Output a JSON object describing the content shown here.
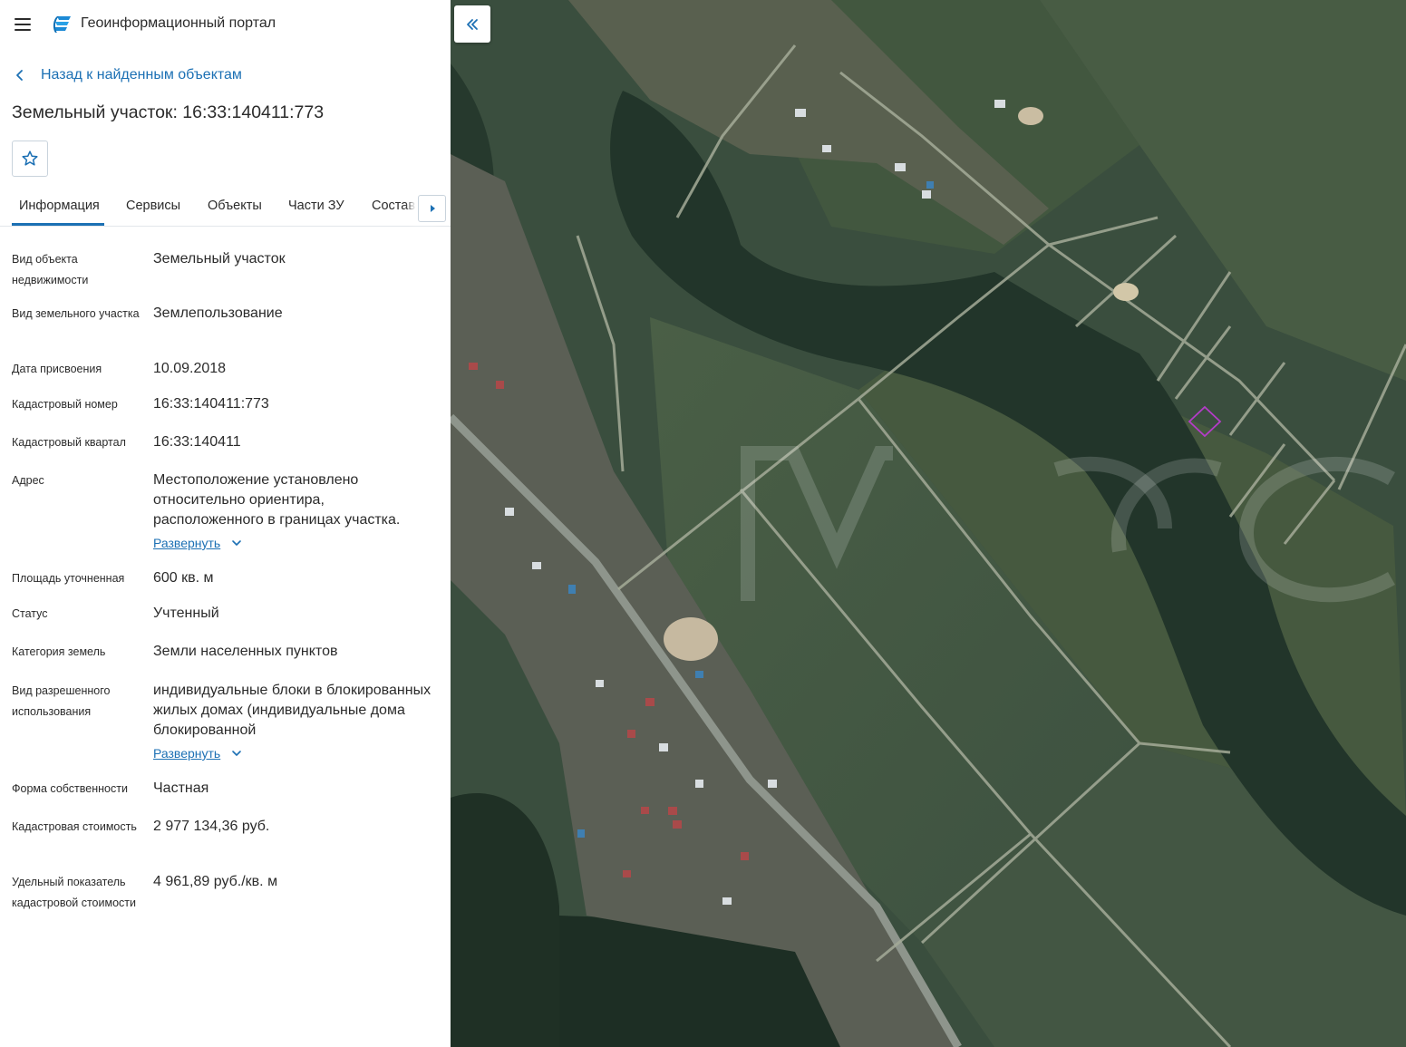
{
  "app": {
    "title": "Геоинформационный портал",
    "menu_icon": "hamburger-icon",
    "logo_icon": "portal-logo-icon"
  },
  "nav": {
    "back_label": "Назад к найденным объектам"
  },
  "object": {
    "title": "Земельный участок: 16:33:140411:773"
  },
  "tabs": [
    {
      "label": "Информация",
      "active": true
    },
    {
      "label": "Сервисы",
      "active": false
    },
    {
      "label": "Объекты",
      "active": false
    },
    {
      "label": "Части ЗУ",
      "active": false
    },
    {
      "label": "Состав",
      "active": false
    }
  ],
  "info": [
    {
      "label": "Вид объекта недвижимости",
      "value": "Земельный участок"
    },
    {
      "label": "Вид земельного участка",
      "value": "Землепользование"
    },
    {
      "label": "Дата присвоения",
      "value": "10.09.2018"
    },
    {
      "label": "Кадастровый номер",
      "value": "16:33:140411:773"
    },
    {
      "label": "Кадастровый квартал",
      "value": "16:33:140411"
    },
    {
      "label": "Адрес",
      "value": "Местоположение установлено относительно ориентира, расположенного в границах участка.",
      "expand": "Развернуть"
    },
    {
      "label": "Площадь уточненная",
      "value": "600 кв. м"
    },
    {
      "label": "Статус",
      "value": "Учтенный"
    },
    {
      "label": "Категория земель",
      "value": "Земли населенных пунктов"
    },
    {
      "label": "Вид разрешенного использования",
      "value": "индивидуальные блоки в блокированных жилых домах (индивидуальные дома блокированной",
      "expand": "Развернуть"
    },
    {
      "label": "Форма собственности",
      "value": "Частная"
    },
    {
      "label": "Кадастровая стоимость",
      "value": "2 977 134,36 руб."
    },
    {
      "label": "Удельный показатель кадастровой стоимости",
      "value": "4 961,89 руб./кв. м"
    }
  ],
  "colors": {
    "accent": "#1c70b4",
    "parcel_outline": "#b43cc8"
  },
  "icons": {
    "favorite": "star-icon",
    "tabs_scroll": "caret-right-icon",
    "collapse": "double-chevron-left-icon",
    "expand": "chevron-down-icon",
    "back": "chevron-left-icon"
  }
}
